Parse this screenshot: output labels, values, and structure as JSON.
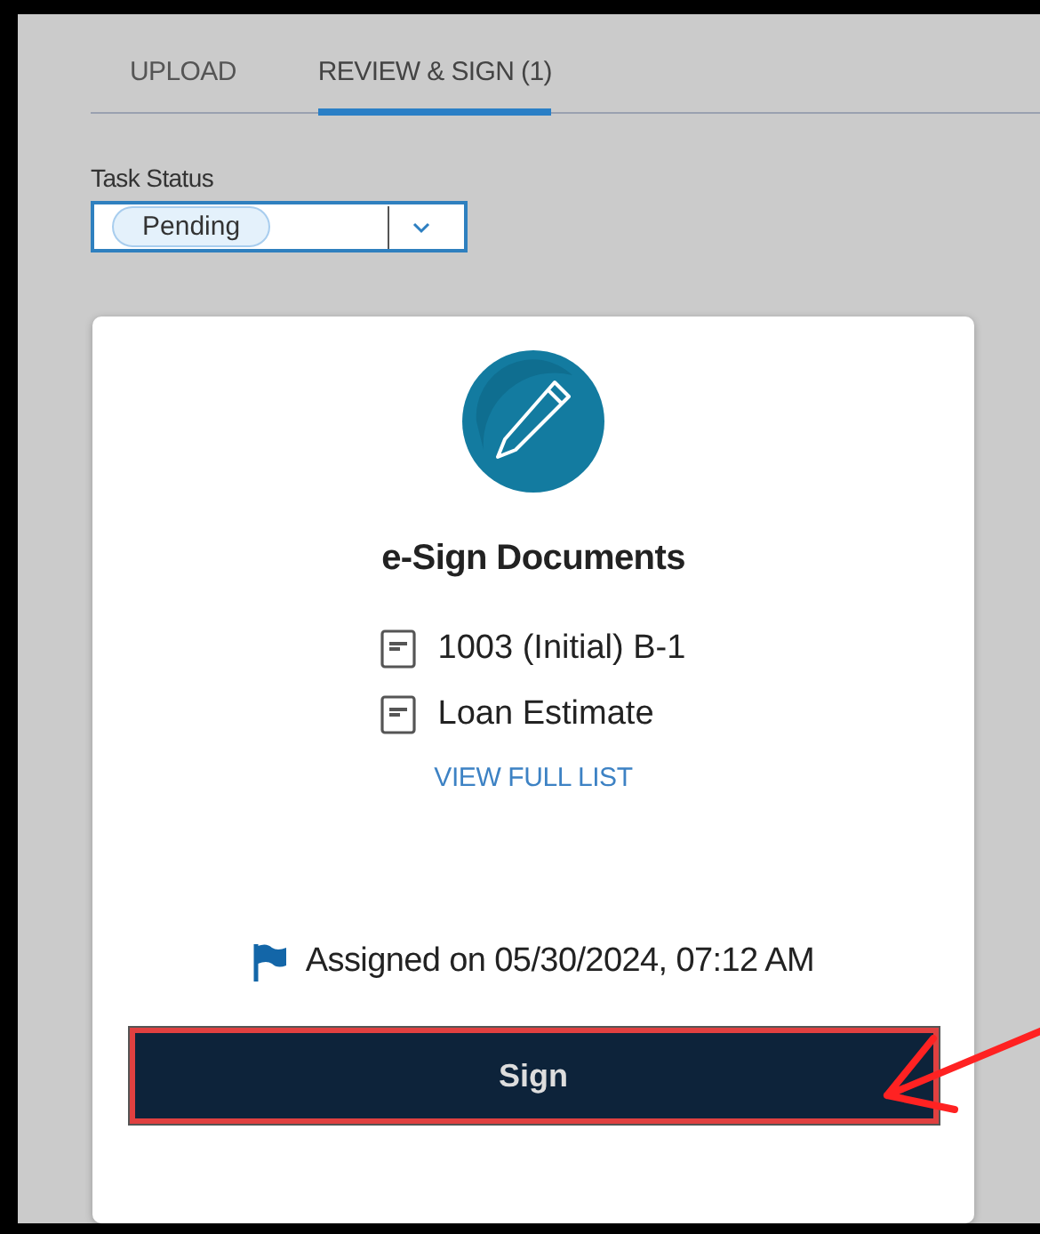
{
  "tabs": [
    {
      "label": "UPLOAD",
      "selected": false
    },
    {
      "label": "REVIEW & SIGN (1)",
      "selected": true
    }
  ],
  "task_status": {
    "label": "Task Status",
    "value": "Pending"
  },
  "card": {
    "title": "e-Sign Documents",
    "documents": [
      "1003 (Initial) B-1",
      "Loan Estimate"
    ],
    "link": "VIEW FULL LIST",
    "assigned": "Assigned on 05/30/2024, 07:12 AM",
    "button": "Sign"
  }
}
